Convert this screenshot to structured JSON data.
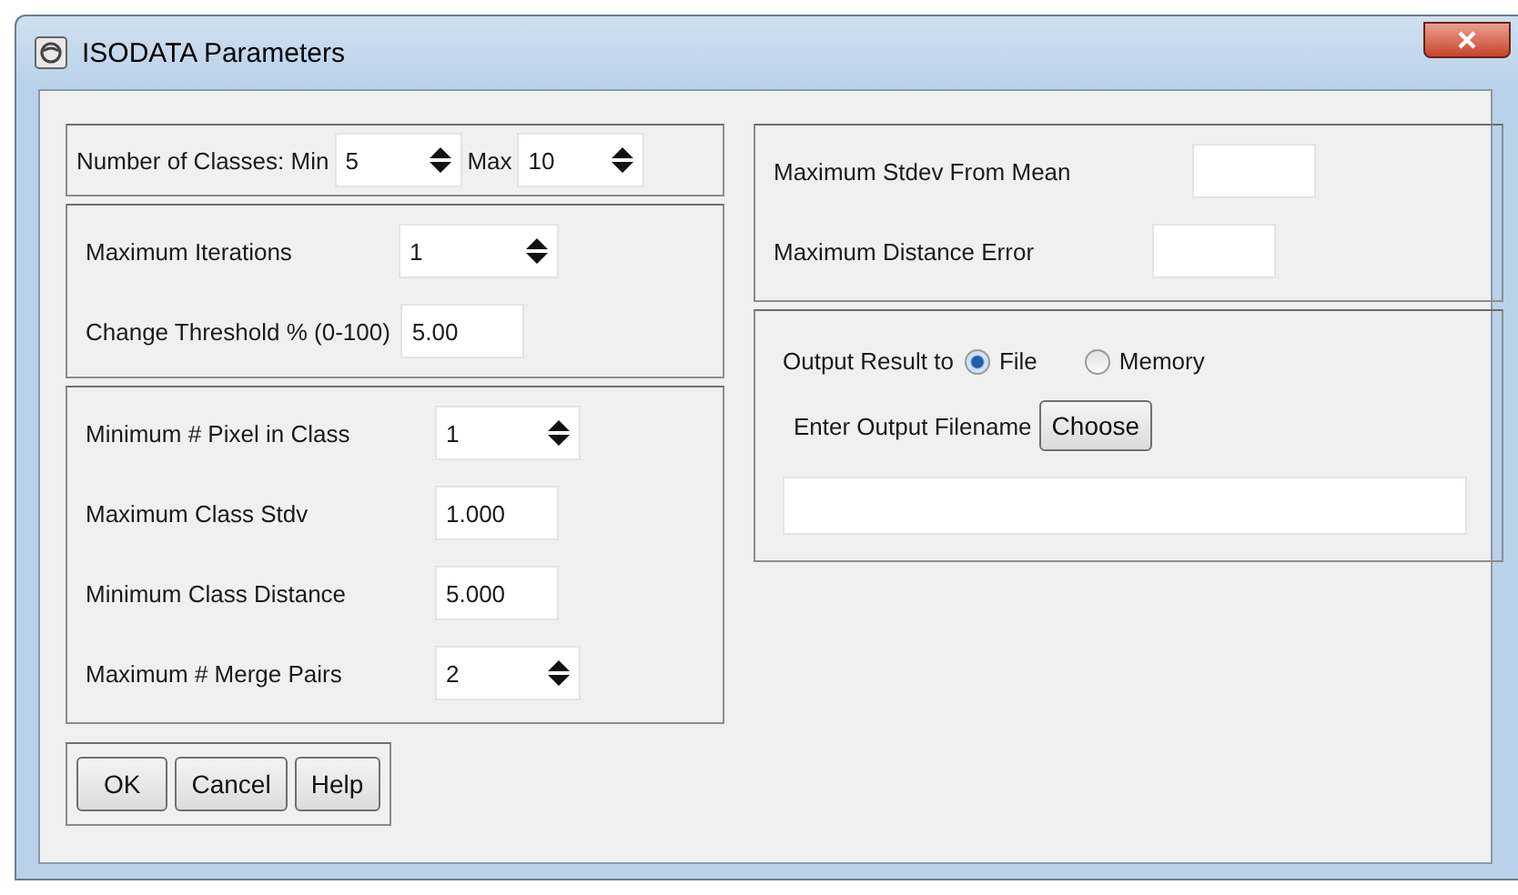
{
  "window": {
    "title": "ISODATA Parameters"
  },
  "class_range": {
    "min_label": "Number of Classes: Min",
    "min": "5",
    "max_label": "Max",
    "max": "10"
  },
  "left_groups": [
    {
      "fields": [
        {
          "label": "Maximum Iterations",
          "value": "1",
          "kind": "spinner"
        },
        {
          "label": "Change Threshold % (0-100)",
          "value": "5.00",
          "kind": "text"
        }
      ]
    },
    {
      "fields": [
        {
          "label": "Minimum # Pixel in Class",
          "value": "1",
          "kind": "spinner"
        },
        {
          "label": "Maximum Class Stdv",
          "value": "1.000",
          "kind": "text"
        },
        {
          "label": "Minimum Class Distance",
          "value": "5.000",
          "kind": "text"
        },
        {
          "label": "Maximum # Merge Pairs",
          "value": "2",
          "kind": "spinner"
        }
      ]
    }
  ],
  "right_fields": [
    {
      "label": "Maximum Stdev From Mean",
      "kind": "text"
    },
    {
      "label": "Maximum Distance Error",
      "kind": "text"
    }
  ],
  "output": {
    "label": "Output Result to",
    "options": [
      {
        "label": "File",
        "selected": true
      },
      {
        "label": "Memory",
        "selected": false
      }
    ],
    "filename_label": "Enter Output Filename",
    "choose_button": "Choose"
  },
  "buttons": [
    "OK",
    "Cancel",
    "Help"
  ]
}
